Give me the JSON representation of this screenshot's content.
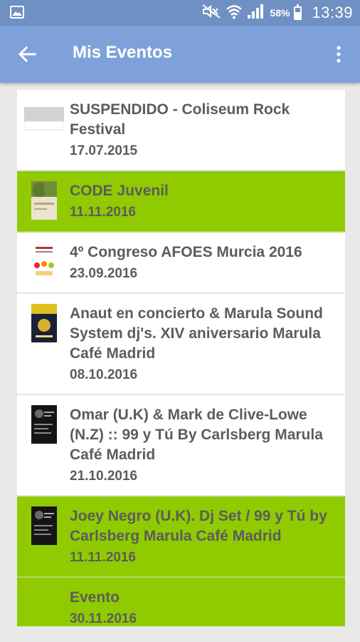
{
  "status_bar": {
    "battery_pct": "58%",
    "battery_level": 0.58,
    "time": "13:39",
    "icons": [
      "gallery-icon",
      "mute-icon",
      "wifi-icon",
      "signal-icon",
      "battery-icon"
    ]
  },
  "action_bar": {
    "title": "Mis Eventos",
    "back_icon": "arrow-left-icon",
    "overflow_icon": "more-vert-icon"
  },
  "colors": {
    "status_bar": "#6f90c2",
    "action_bar": "#7ea1da",
    "highlight": "#8fcb00",
    "text": "#5c5c5c"
  },
  "events": [
    {
      "name": "SUSPENDIDO - Coliseum Rock Festival",
      "date": "17.07.2015",
      "highlighted": false
    },
    {
      "name": "CODE Juvenil",
      "date": "11.11.2016",
      "highlighted": true
    },
    {
      "name": "4º Congreso AFOES Murcia 2016",
      "date": "23.09.2016",
      "highlighted": false
    },
    {
      "name": "Anaut en concierto & Marula Sound System dj's. XIV aniversario Marula Café Madrid",
      "date": "08.10.2016",
      "highlighted": false
    },
    {
      "name": "Omar (U.K) & Mark de Clive-Lowe (N.Z) :: 99 y Tú By Carlsberg Marula Café Madrid",
      "date": "21.10.2016",
      "highlighted": false
    },
    {
      "name": "Joey Negro (U.K). Dj Set / 99 y Tú by Carlsberg Marula Café Madrid",
      "date": "11.11.2016",
      "highlighted": true
    },
    {
      "name": "Evento",
      "date": "30.11.2016",
      "highlighted": true
    }
  ]
}
